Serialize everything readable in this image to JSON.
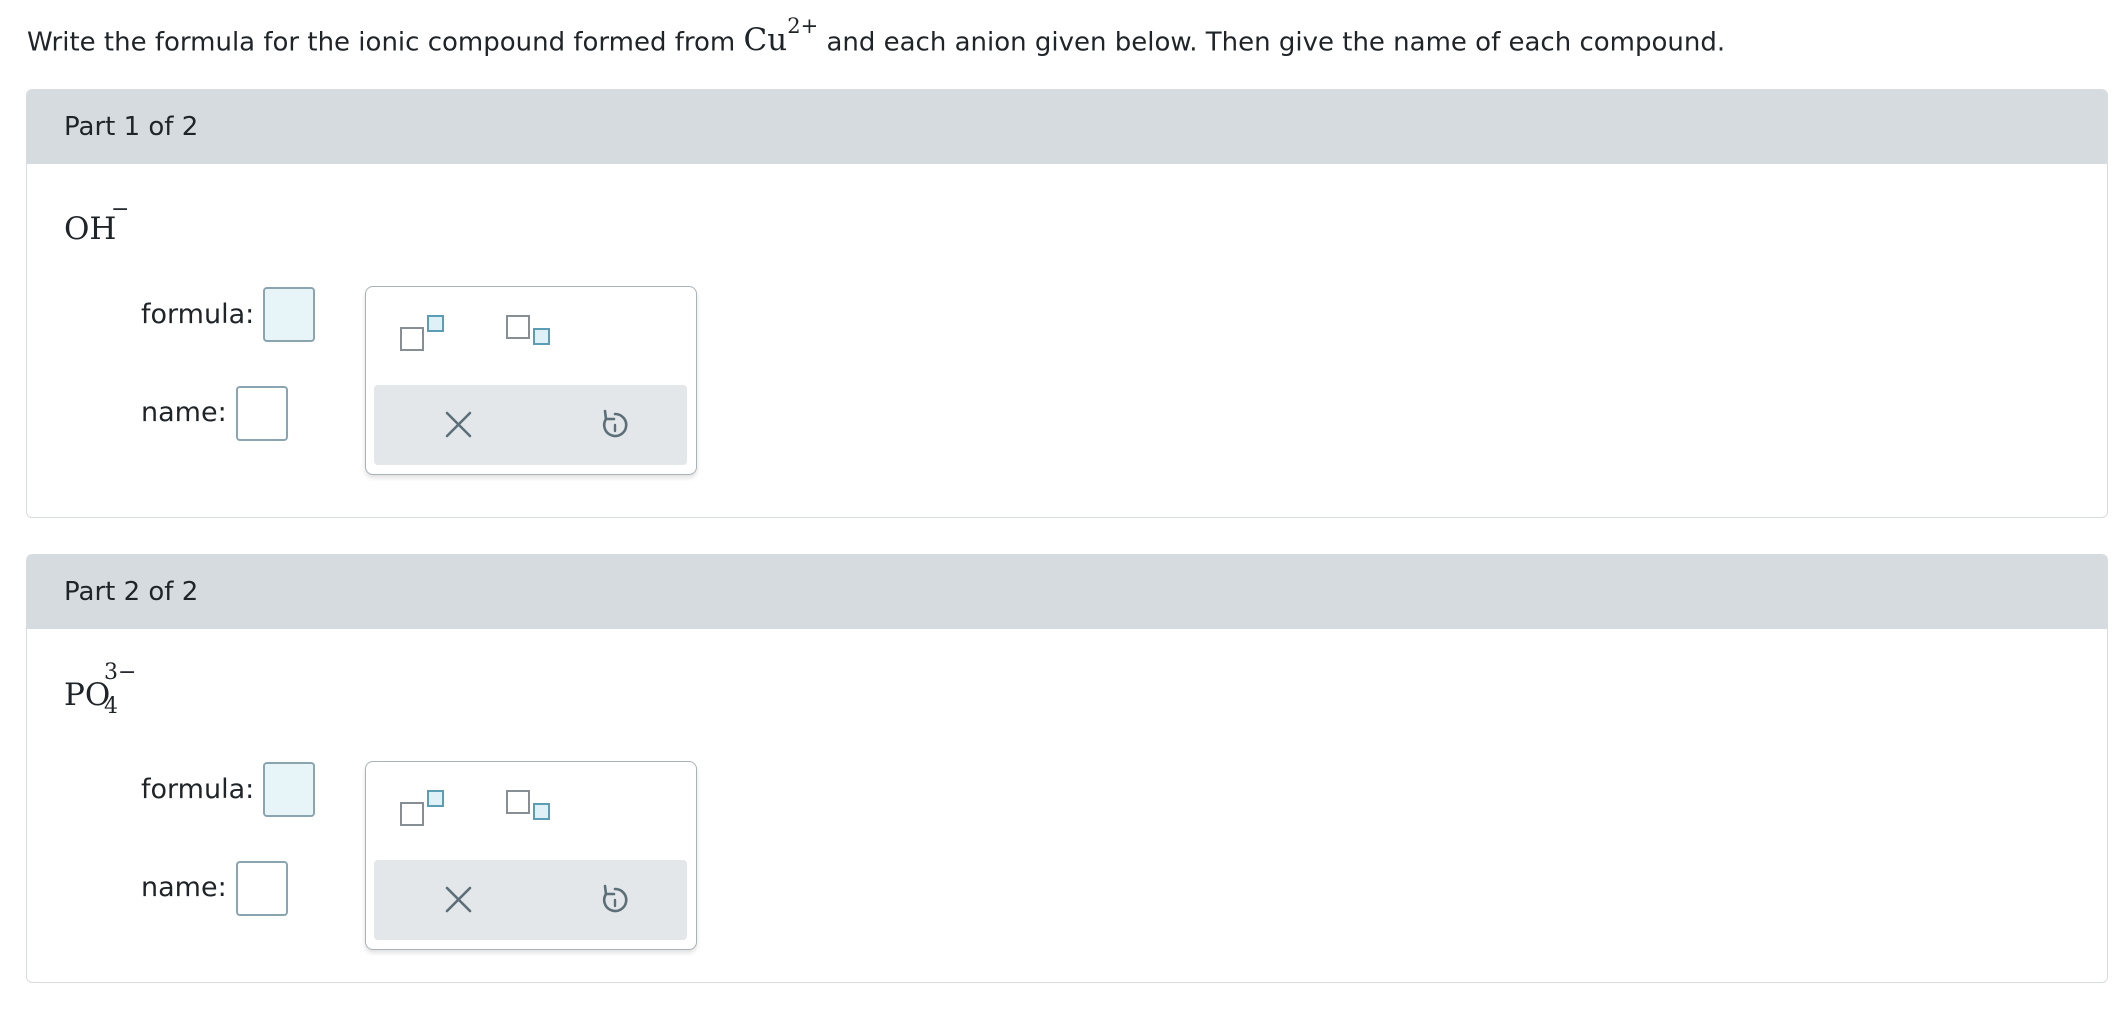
{
  "question": {
    "text_before": "Write the formula for the ionic compound formed from ",
    "cation": "Cu",
    "cation_charge": "2+",
    "text_after": " and each anion given below. Then give the name of each compound."
  },
  "parts": [
    {
      "header": "Part 1 of 2",
      "anion_base": "OH",
      "anion_sub": "",
      "anion_charge": "−",
      "formula_label": "formula:",
      "name_label": "name:"
    },
    {
      "header": "Part 2 of 2",
      "anion_base": "PO",
      "anion_sub": "4",
      "anion_charge": "3−",
      "formula_label": "formula:",
      "name_label": "name:"
    }
  ],
  "palette": {
    "icons": [
      "superscript-icon",
      "subscript-icon",
      "clear-icon",
      "undo-icon"
    ]
  },
  "colors": {
    "header_bg": "#d5dbde",
    "input_bg": "#e8f5f8",
    "input_border": "#8ba5b0",
    "toolbar_bg": "#e3e7e9",
    "icon_stroke": "#5c6f78",
    "highlight_box": "#5a9db4"
  }
}
